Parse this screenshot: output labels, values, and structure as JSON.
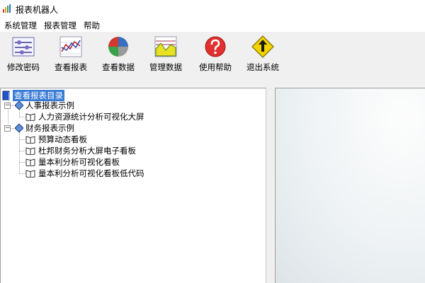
{
  "window": {
    "title": "报表机器人",
    "app_icon": "bar-chart-icon"
  },
  "menu": [
    "系统管理",
    "报表管理",
    "帮助"
  ],
  "toolbar": {
    "items": [
      {
        "label": "修改密码",
        "icon": "password-settings-icon"
      },
      {
        "label": "查看报表",
        "icon": "line-chart-icon"
      },
      {
        "label": "查看数据",
        "icon": "pie-chart-icon"
      },
      {
        "label": "管理数据",
        "icon": "area-chart-icon"
      },
      {
        "label": "使用帮助",
        "icon": "help-icon"
      },
      {
        "label": "退出系统",
        "icon": "exit-icon"
      }
    ]
  },
  "tree": {
    "root": "查看报表目录",
    "groups": [
      {
        "label": "人事报表示例",
        "items": [
          "人力资源统计分析可视化大屏"
        ]
      },
      {
        "label": "财务报表示例",
        "items": [
          "预算动态看板",
          "杜邦财务分析大屏电子看板",
          "量本利分析可视化看板",
          "量本利分析可视化看板低代码"
        ]
      }
    ]
  },
  "colors": {
    "selection": "#3a7bd5",
    "accent_help": "#e03030",
    "accent_exit": "#f3d400"
  }
}
